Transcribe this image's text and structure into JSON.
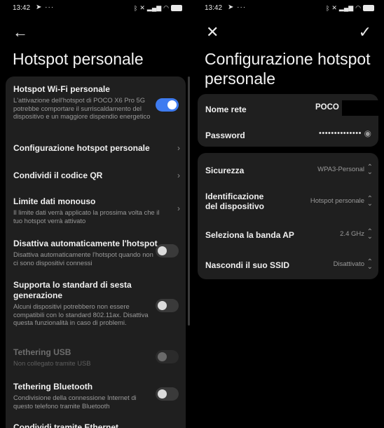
{
  "status_bar": {
    "time": "13:42",
    "notif_icons": "➤ ···"
  },
  "left": {
    "title": "Hotspot personale",
    "rows": [
      {
        "title": "Hotspot Wi-Fi personale",
        "subtitle": "L'attivazione dell'hotspot di POCO X6 Pro 5G potrebbe comportare il surriscaldamento del dispositivo e un maggiore dispendio energetico",
        "control": "toggle-on"
      },
      {
        "title": "Configurazione hotspot personale",
        "control": "chevron"
      },
      {
        "title": "Condividi il codice QR",
        "control": "chevron"
      },
      {
        "title": "Limite dati monouso",
        "subtitle": "Il limite dati verrà applicato la prossima volta che il tuo hotspot verrà attivato",
        "control": "chevron"
      },
      {
        "title": "Disattiva automaticamente l'hotspot",
        "subtitle": "Disattiva automaticamente l'hotspot quando non ci sono dispositivi connessi",
        "control": "toggle-off"
      },
      {
        "title": "Supporta lo standard di sesta generazione",
        "subtitle": "Alcuni dispositivi potrebbero non essere compatibili con lo standard 802.11ax. Disattiva questa funzionalità in caso di problemi.",
        "control": "toggle-off"
      },
      {
        "title": "Tethering USB",
        "subtitle": "Non collegato tramite USB",
        "control": "toggle-disabled"
      },
      {
        "title": "Tethering Bluetooth",
        "subtitle": "Condivisione della connessione Internet di questo telefono tramite Bluetooth",
        "control": "toggle-off"
      },
      {
        "title": "Condividi tramite Ethernet"
      }
    ]
  },
  "right": {
    "title": "Configurazione hotspot personale",
    "network_name_label": "Nome rete",
    "network_name_value": "POCO",
    "password_label": "Password",
    "password_value": "••••••••••••••",
    "security_label": "Sicurezza",
    "security_value": "WPA3-Personal",
    "device_id_label": "Identificazione del dispositivo",
    "device_id_value": "Hotspot personale",
    "ap_band_label": "Seleziona la banda AP",
    "ap_band_value": "2.4 GHz",
    "hide_ssid_label": "Nascondi il suo SSID",
    "hide_ssid_value": "Disattivato"
  },
  "colors": {
    "accent": "#3e7bf0",
    "card": "#1f1f1f",
    "background": "#000000"
  }
}
